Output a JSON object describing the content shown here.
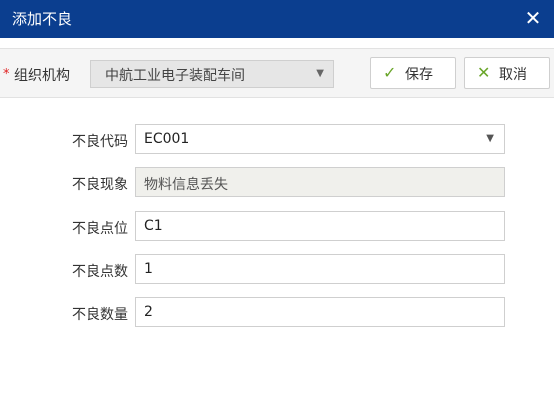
{
  "dialog": {
    "title": "添加不良",
    "close_glyph": "✕"
  },
  "toolbar": {
    "required_mark": "*",
    "org_label": "组织机构",
    "org_value": "中航工业电子装配车间",
    "save_label": "保存",
    "cancel_label": "取消"
  },
  "form": {
    "fields": [
      {
        "label": "不良代码",
        "value": "EC001",
        "type": "select"
      },
      {
        "label": "不良现象",
        "value": "物料信息丢失",
        "type": "readonly"
      },
      {
        "label": "不良点位",
        "value": "C1",
        "type": "text"
      },
      {
        "label": "不良点数",
        "value": "1",
        "type": "text"
      },
      {
        "label": "不良数量",
        "value": "2",
        "type": "text"
      }
    ]
  },
  "icons": {
    "dropdown": "chevron-down-icon",
    "save": "checkmark-icon",
    "cancel": "cross-icon",
    "close": "close-icon"
  },
  "colors": {
    "titlebar": "#0b3e8f",
    "accent_icon": "#6aa62a",
    "required": "#e02020"
  }
}
